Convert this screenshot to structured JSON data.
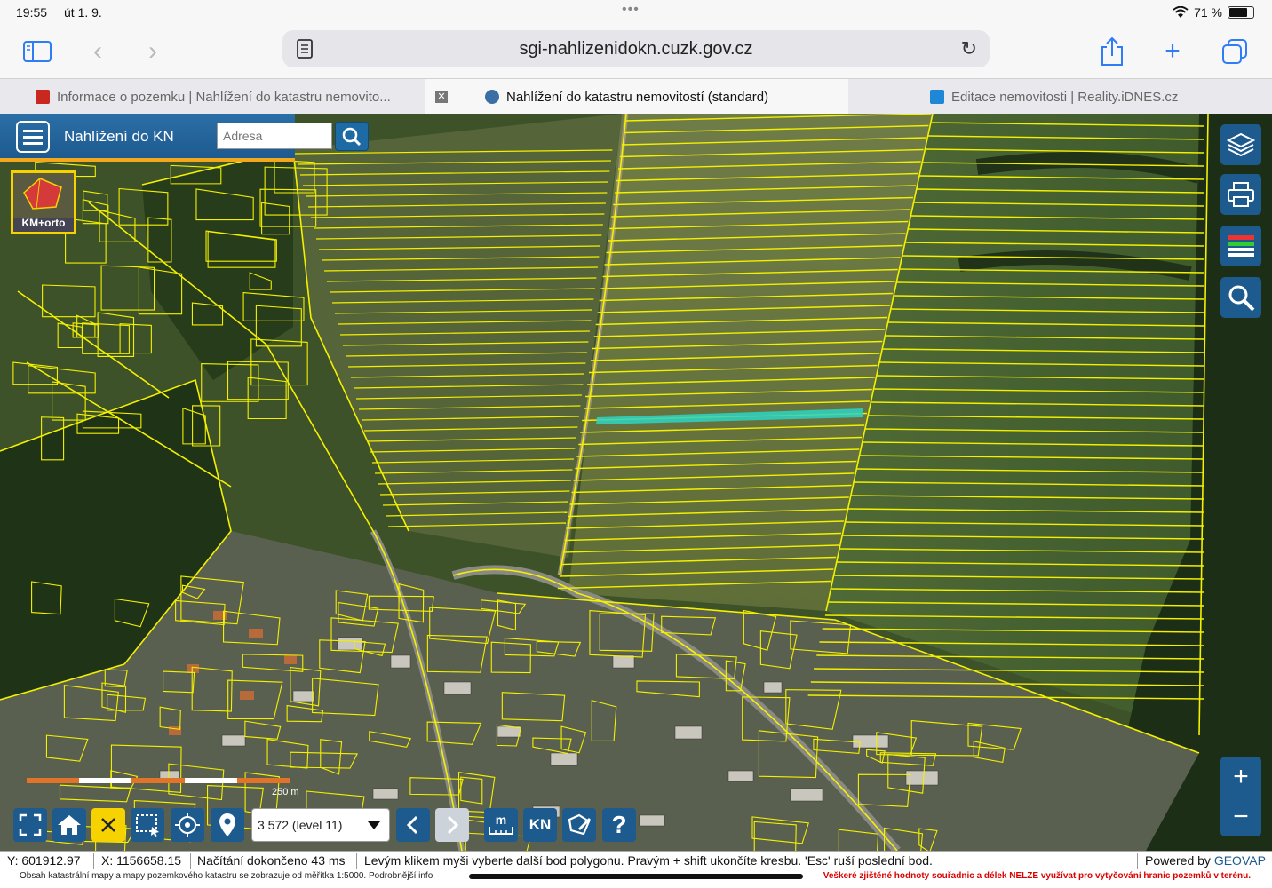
{
  "status_bar": {
    "time": "19:55",
    "date": "út 1. 9.",
    "battery": "71 %",
    "battery_level": 0.71
  },
  "browser": {
    "url": "sgi-nahlizenidokn.cuzk.gov.cz",
    "tabs": [
      {
        "label": "Informace o pozemku | Nahlížení do katastru nemovito...",
        "active": false
      },
      {
        "label": "Nahlížení do katastru nemovitostí (standard)",
        "active": true
      },
      {
        "label": "Editace nemovitosti | Reality.iDNES.cz",
        "active": false
      }
    ]
  },
  "app": {
    "title": "Nahlížení do KN",
    "address_placeholder": "Adresa",
    "layer_label": "KM+orto",
    "scale_value": "3 572 (level 11)",
    "scale_bar_label": "250 m",
    "tool_labels": {
      "kn": "KN",
      "measure": "m"
    }
  },
  "info_bar": {
    "y": "Y: 601912.97",
    "x": "X: 1156658.15",
    "loading": "Načítání dokončeno 43 ms",
    "hint": "Levým klikem myši vyberte další bod polygonu. Pravým + shift ukončíte kresbu. 'Esc' ruší poslední bod.",
    "powered": "Powered by",
    "brand": "GEOVAP"
  },
  "disclaimer": {
    "left": "Obsah katastrální mapy a mapy pozemkového katastru se zobrazuje od měřítka 1:5000. Podrobnější info",
    "right": "Veškeré zjištěné hodnoty souřadnic a délek NELZE využívat pro vytyčování hranic pozemků v terénu."
  },
  "colors": {
    "accent": "#1d5a8e",
    "parcel_line": "#f3f000",
    "selected_parcel": "#2ed3c3",
    "header_underline": "#f2a81d"
  }
}
